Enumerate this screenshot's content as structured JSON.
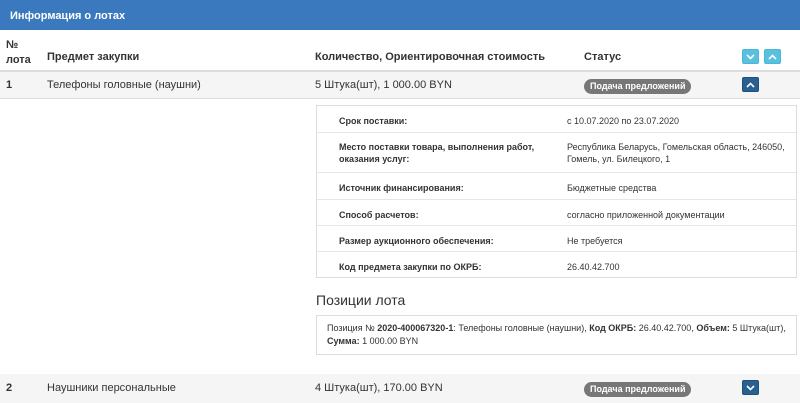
{
  "header": {
    "title": "Информация о лотах"
  },
  "table": {
    "col_num_line1": "№",
    "col_num_line2": "лота",
    "col_subject": "Предмет закупки",
    "col_qty": "Количество, Ориентировочная стоимость",
    "col_status": "Статус"
  },
  "lots": [
    {
      "num": "1",
      "subject": "Телефоны головные (наушни)",
      "qty": "5 Штука(шт), 1 000.00 BYN",
      "status": "Подача предложений",
      "details": [
        {
          "label": "Срок поставки:",
          "value": "с 10.07.2020 по 23.07.2020"
        },
        {
          "label": "Место поставки товара, выполнения работ, оказания услуг:",
          "value": "Республика Беларусь, Гомельская область, 246050, Гомель, ул. Билецкого, 1"
        },
        {
          "label": "Источник финансирования:",
          "value": "Бюджетные средства"
        },
        {
          "label": "Способ расчетов:",
          "value": "согласно приложенной документации"
        },
        {
          "label": "Размер аукционного обеспечения:",
          "value": "Не требуется"
        },
        {
          "label": "Код предмета закупки по ОКРБ:",
          "value": "26.40.42.700"
        }
      ],
      "positions_title": "Позиции лота",
      "position": {
        "prefix": "Позиция № ",
        "number": "2020-400067320-1",
        "name": ": Телефоны головные (наушни), ",
        "okrb_label": "Код ОКРБ:",
        "okrb_value": " 26.40.42.700, ",
        "volume_label": "Объем:",
        "volume_value": " 5 Штука(шт),",
        "sum_label": "Сумма:",
        "sum_value": " 1 000.00 BYN"
      }
    },
    {
      "num": "2",
      "subject": "Наушники персональные",
      "qty": "4 Штука(шт), 170.00 BYN",
      "status": "Подача предложений"
    }
  ],
  "icons": {
    "expand_all": "chevron-down-icon",
    "collapse_all": "chevron-up-icon",
    "collapse_lot": "chevron-up-icon",
    "expand_lot": "chevron-down-icon"
  },
  "colors": {
    "header_bg": "#3a79bd",
    "button_light": "#5bc0de",
    "button_dark": "#286090",
    "badge_bg": "#777777"
  }
}
